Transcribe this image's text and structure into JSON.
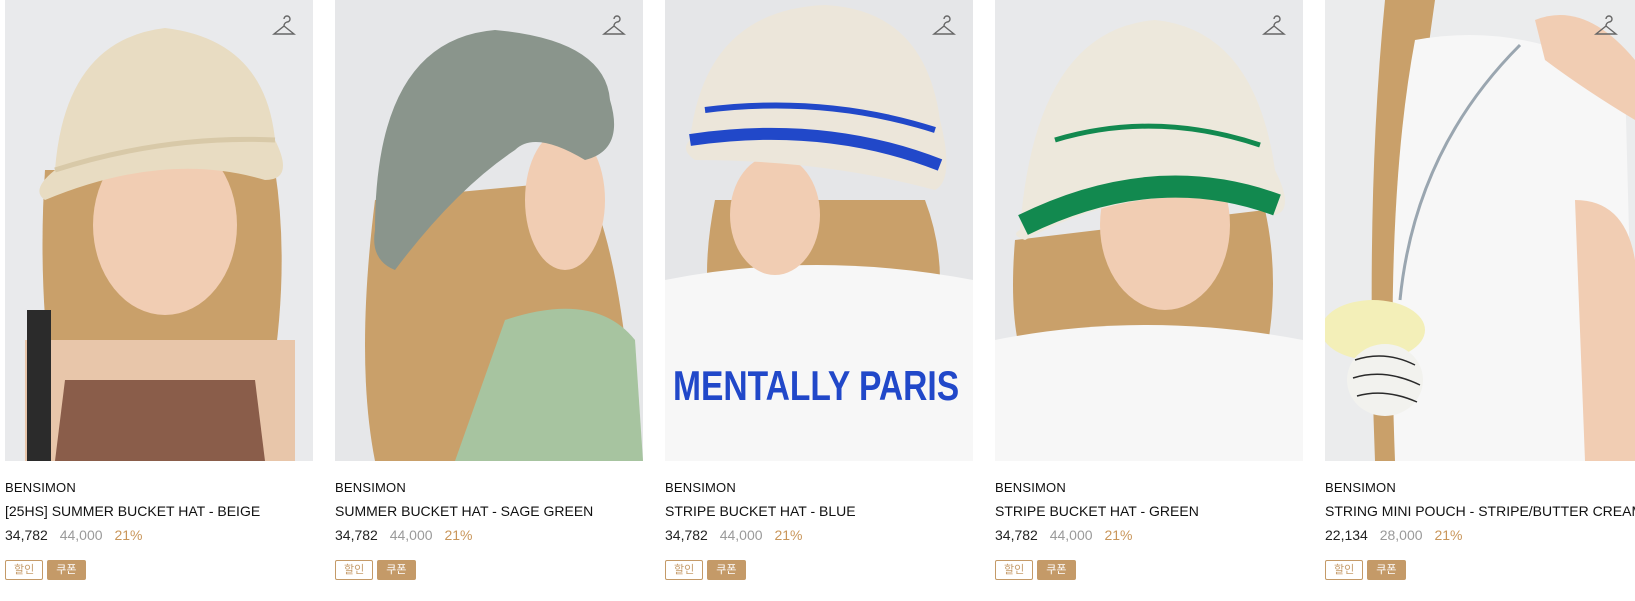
{
  "products": [
    {
      "brand": "BENSIMON",
      "name": "[25HS] SUMMER BUCKET HAT - BEIGE",
      "sale_price": "34,782",
      "original_price": "44,000",
      "discount_rate": "21%",
      "badges": [
        "할인",
        "쿠폰"
      ],
      "hat_color": "#e8dcc2",
      "stripe_color": "",
      "clothing_color": "#8a5d4a",
      "wishlist_icon": "hanger-icon"
    },
    {
      "brand": "BENSIMON",
      "name": "SUMMER BUCKET HAT - SAGE GREEN",
      "sale_price": "34,782",
      "original_price": "44,000",
      "discount_rate": "21%",
      "badges": [
        "할인",
        "쿠폰"
      ],
      "hat_color": "#8a958c",
      "stripe_color": "",
      "clothing_color": "#a7c4a0",
      "wishlist_icon": "hanger-icon"
    },
    {
      "brand": "BENSIMON",
      "name": "STRIPE BUCKET HAT - BLUE",
      "sale_price": "34,782",
      "original_price": "44,000",
      "discount_rate": "21%",
      "badges": [
        "할인",
        "쿠폰"
      ],
      "hat_color": "#ece6da",
      "stripe_color": "#2148c9",
      "clothing_color": "#f7f7f7",
      "wishlist_icon": "hanger-icon"
    },
    {
      "brand": "BENSIMON",
      "name": "STRIPE BUCKET HAT - GREEN",
      "sale_price": "34,782",
      "original_price": "44,000",
      "discount_rate": "21%",
      "badges": [
        "할인",
        "쿠폰"
      ],
      "hat_color": "#ede8dc",
      "stripe_color": "#12894f",
      "clothing_color": "#f7f7f7",
      "wishlist_icon": "hanger-icon"
    },
    {
      "brand": "BENSIMON",
      "name": "STRING MINI POUCH - STRIPE/BUTTER CREAM",
      "sale_price": "22,134",
      "original_price": "28,000",
      "discount_rate": "21%",
      "badges": [
        "할인",
        "쿠폰"
      ],
      "hat_color": "",
      "stripe_color": "#2a2a2a",
      "clothing_color": "#f7f7f7",
      "wishlist_icon": "hanger-icon"
    }
  ],
  "colors": {
    "accent": "#c49a68",
    "discount": "#c9965a",
    "original_price": "#9a9a9a",
    "background_photo": "#ececec",
    "hair": "#c9a06a"
  }
}
